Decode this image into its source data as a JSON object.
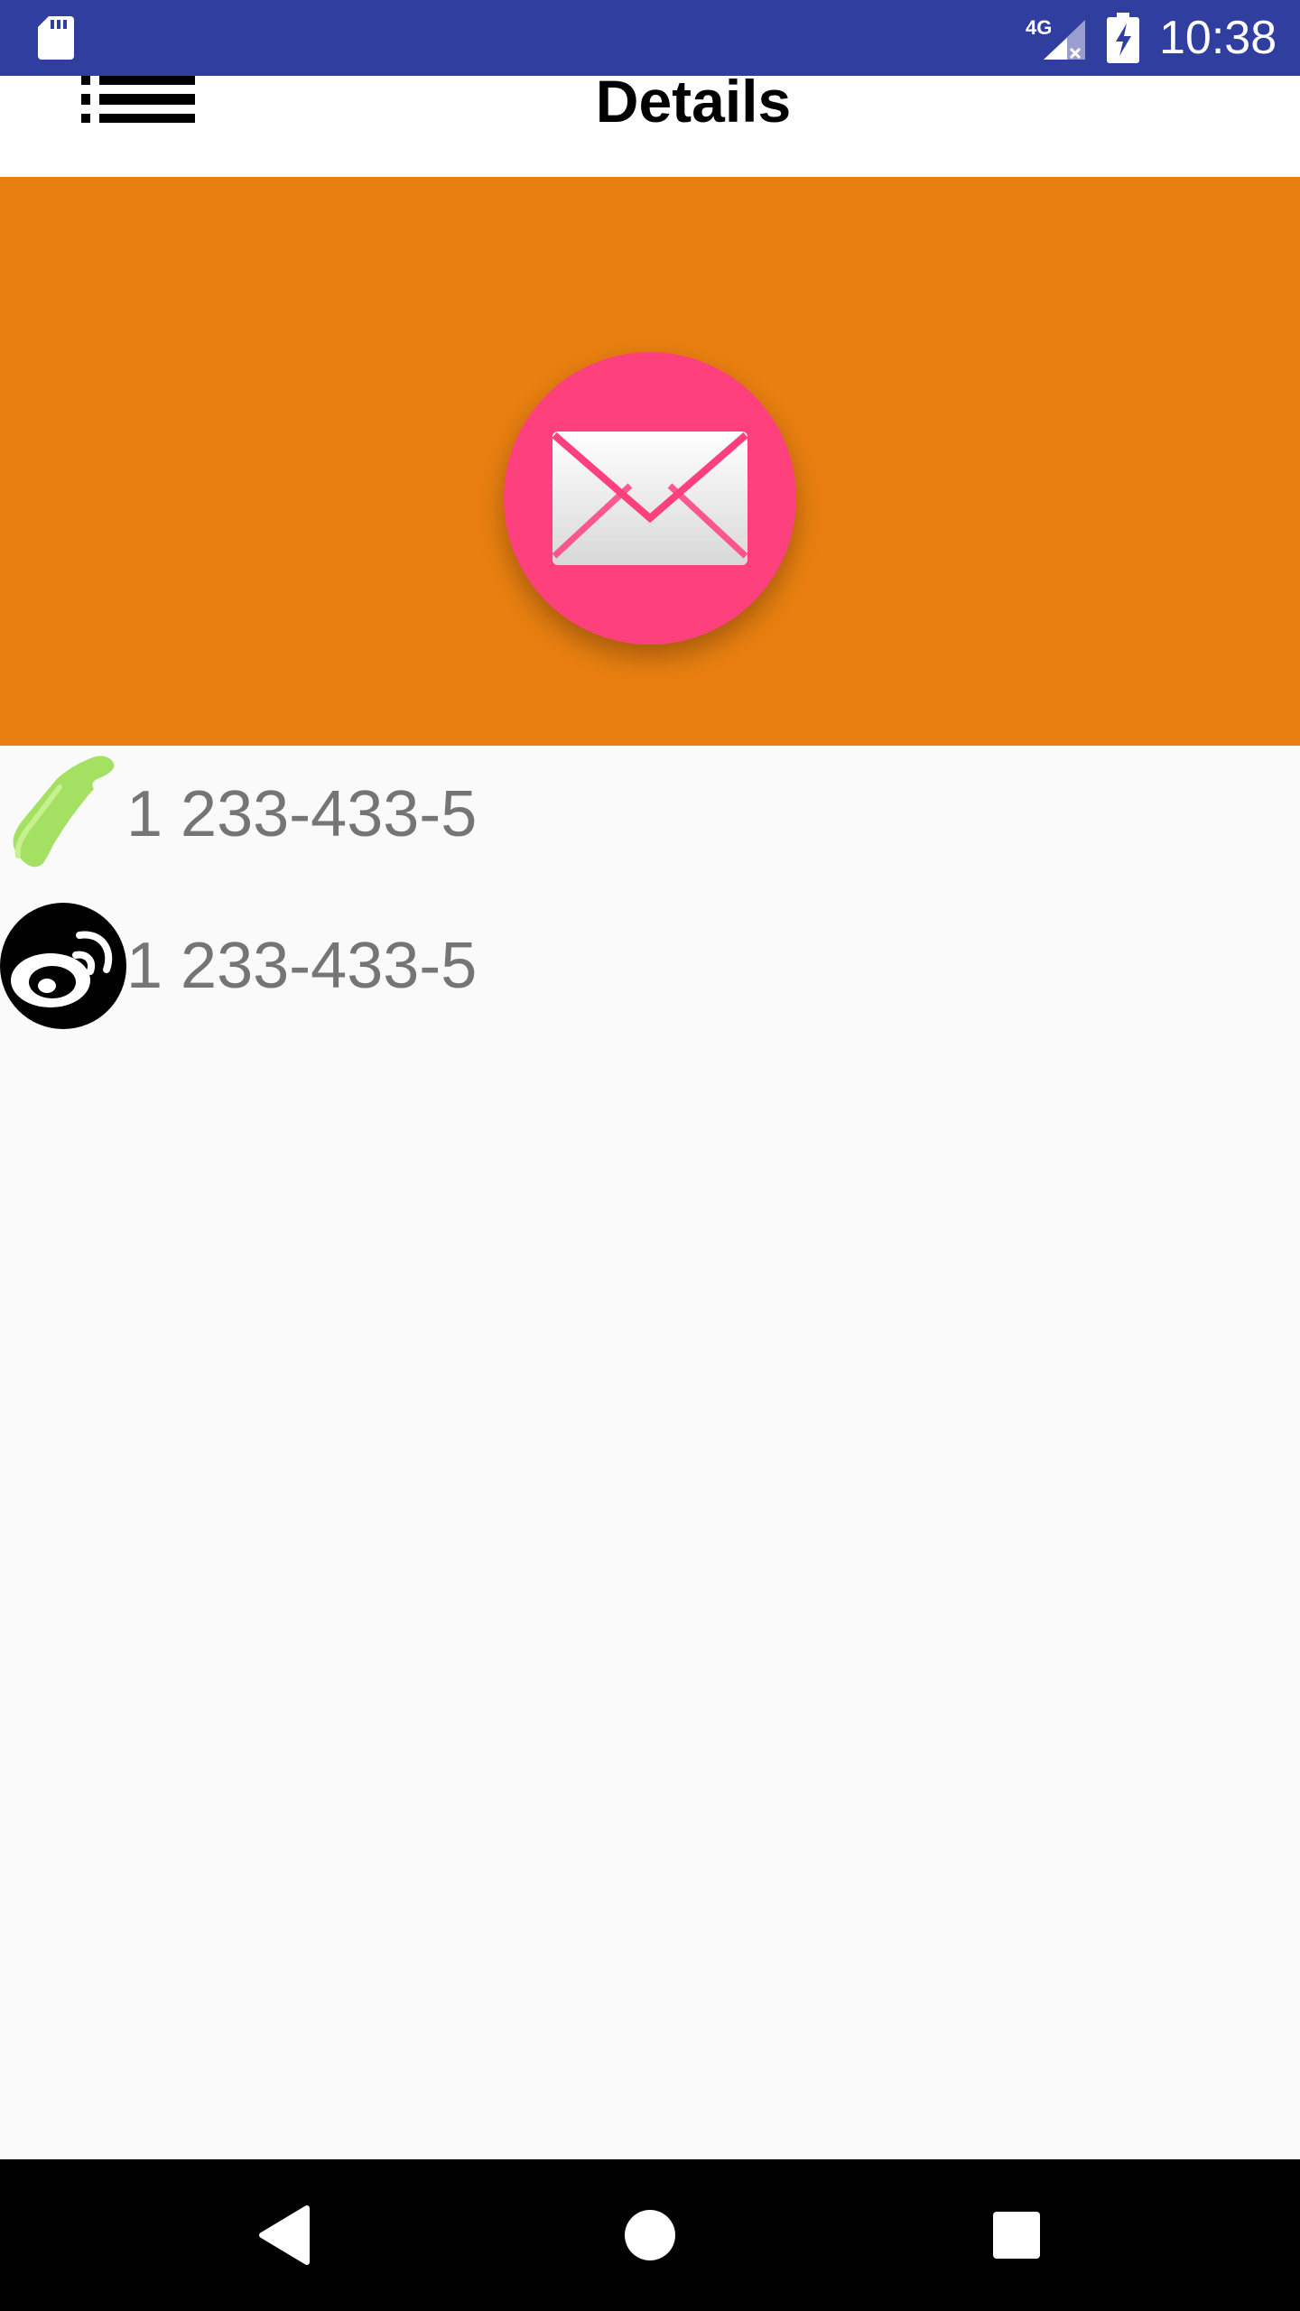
{
  "status_bar": {
    "time": "10:38",
    "network": "4G",
    "icons": [
      "sd-card-icon",
      "signal-icon",
      "battery-charging-icon"
    ]
  },
  "app_bar": {
    "title": "Details",
    "menu_icon": "menu-icon"
  },
  "header": {
    "background_color": "#e87f10",
    "action_button": {
      "icon": "mail-icon",
      "color": "#fe407d"
    }
  },
  "contacts": [
    {
      "icon": "phone-icon",
      "value": "1 233-433-5"
    },
    {
      "icon": "weibo-icon",
      "value": "1 233-433-5"
    }
  ],
  "nav_bar": {
    "buttons": [
      "back-icon",
      "home-icon",
      "recents-icon"
    ]
  }
}
